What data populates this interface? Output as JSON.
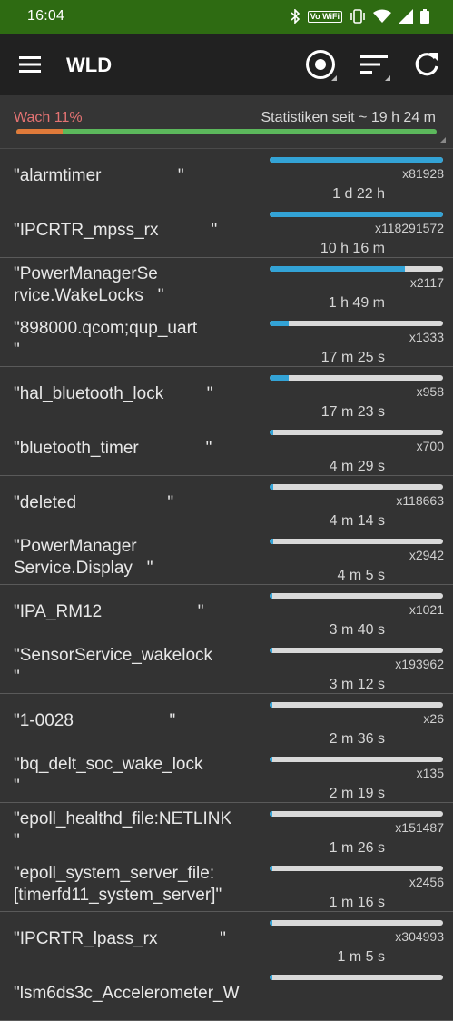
{
  "status_bar": {
    "time": "16:04",
    "vowifi": "Vo WiFi",
    "icons": [
      "bluetooth-icon",
      "vowifi-icon",
      "vibrate-icon",
      "wifi-icon",
      "signal-icon",
      "battery-icon"
    ]
  },
  "toolbar": {
    "title": "WLD",
    "icons": [
      "menu-icon",
      "target-icon",
      "sort-icon",
      "refresh-icon"
    ]
  },
  "summary": {
    "awake_label": "Wach 11%",
    "awake_fraction": 0.11,
    "stats_label": "Statistiken seit ~ 19 h 24 m",
    "colors": {
      "awake": "#e07a3a",
      "asleep": "#5cb85c",
      "awake_text": "#e57373"
    }
  },
  "accent_color": "#33a3d6",
  "wakelocks": [
    {
      "name": "\"alarmtimer                \"",
      "count": "x81928",
      "duration": "1 d 22 h",
      "fraction": 1.0
    },
    {
      "name": "\"IPCRTR_mpss_rx           \"",
      "count": "x118291572",
      "duration": "10 h 16 m",
      "fraction": 1.0
    },
    {
      "name": "\"PowerManagerSe\nrvice.WakeLocks   \"",
      "count": "x2117",
      "duration": "1 h 49 m",
      "fraction": 0.78
    },
    {
      "name": "\"898000.qcom;qup_uart\n\"",
      "count": "x1333",
      "duration": "17 m 25 s",
      "fraction": 0.11
    },
    {
      "name": "\"hal_bluetooth_lock         \"",
      "count": "x958",
      "duration": "17 m 23 s",
      "fraction": 0.11
    },
    {
      "name": "\"bluetooth_timer              \"",
      "count": "x700",
      "duration": "4 m 29 s",
      "fraction": 0.02
    },
    {
      "name": "\"deleted                   \"",
      "count": "x118663",
      "duration": "4 m 14 s",
      "fraction": 0.02
    },
    {
      "name": "\"PowerManager\nService.Display   \"",
      "count": "x2942",
      "duration": "4 m 5 s",
      "fraction": 0.02
    },
    {
      "name": "\"IPA_RM12                    \"",
      "count": "x1021",
      "duration": "3 m 40 s",
      "fraction": 0.01
    },
    {
      "name": "\"SensorService_wakelock\n\"",
      "count": "x193962",
      "duration": "3 m 12 s",
      "fraction": 0.01
    },
    {
      "name": "\"1-0028                    \"",
      "count": "x26",
      "duration": "2 m 36 s",
      "fraction": 0.01
    },
    {
      "name": "\"bq_delt_soc_wake_lock\n\"",
      "count": "x135",
      "duration": "2 m 19 s",
      "fraction": 0.01
    },
    {
      "name": "\"epoll_healthd_file:NETLINK\n\"",
      "count": "x151487",
      "duration": "1 m 26 s",
      "fraction": 0.01
    },
    {
      "name": "\"epoll_system_server_file:\n[timerfd11_system_server]\"",
      "count": "x2456",
      "duration": "1 m 16 s",
      "fraction": 0.01
    },
    {
      "name": "\"IPCRTR_lpass_rx             \"",
      "count": "x304993",
      "duration": "1 m 5 s",
      "fraction": 0.01
    },
    {
      "name": "\"lsm6ds3c_Accelerometer_W",
      "count": "",
      "duration": "",
      "fraction": 0.01
    }
  ]
}
